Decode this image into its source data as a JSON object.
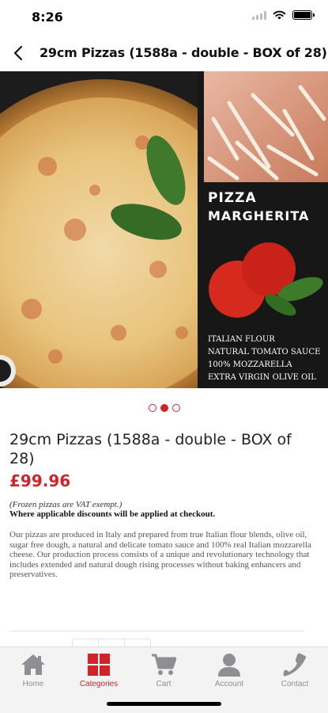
{
  "status_bar": {
    "time": "8:26"
  },
  "header": {
    "title": "29cm Pizzas (1588a - double - BOX of 28)"
  },
  "image_text": {
    "brand_line1": "PIZZA",
    "brand_line2": "MARGHERITA",
    "ingredients": [
      "ITALIAN FLOUR",
      "NATURAL TOMATO SAUCE",
      "100% MOZZARELLA",
      "EXTRA VIRGIN OLIVE OIL"
    ]
  },
  "carousel": {
    "count": 3,
    "active_index": 1
  },
  "product": {
    "title": "29cm Pizzas (1588a - double - BOX of 28)",
    "price": "£99.96",
    "vat_note": "(Frozen pizzas are VAT exempt.)",
    "discount_note": "Where applicable discounts will be applied at checkout.",
    "description": "Our pizzas are produced in Italy and prepared from true Italian flour blends, olive oil, sugar free dough, a natural and delicate tomato sauce and 100% real Italian mozzarella cheese. Our production process consists of a unique and revolutionary technology that includes extended and natural dough rising processes without baking enhancers and preservatives."
  },
  "tab_bar": {
    "items": [
      {
        "label": "Home",
        "icon": "home-icon",
        "active": false
      },
      {
        "label": "Categories",
        "icon": "categories-icon",
        "active": true
      },
      {
        "label": "Cart",
        "icon": "cart-icon",
        "active": false
      },
      {
        "label": "Account",
        "icon": "account-icon",
        "active": false
      },
      {
        "label": "Contact",
        "icon": "phone-icon",
        "active": false
      }
    ]
  },
  "colors": {
    "accent": "#d2232a",
    "inactive": "#8e8e93",
    "tab_bg": "#f3f3f3"
  }
}
